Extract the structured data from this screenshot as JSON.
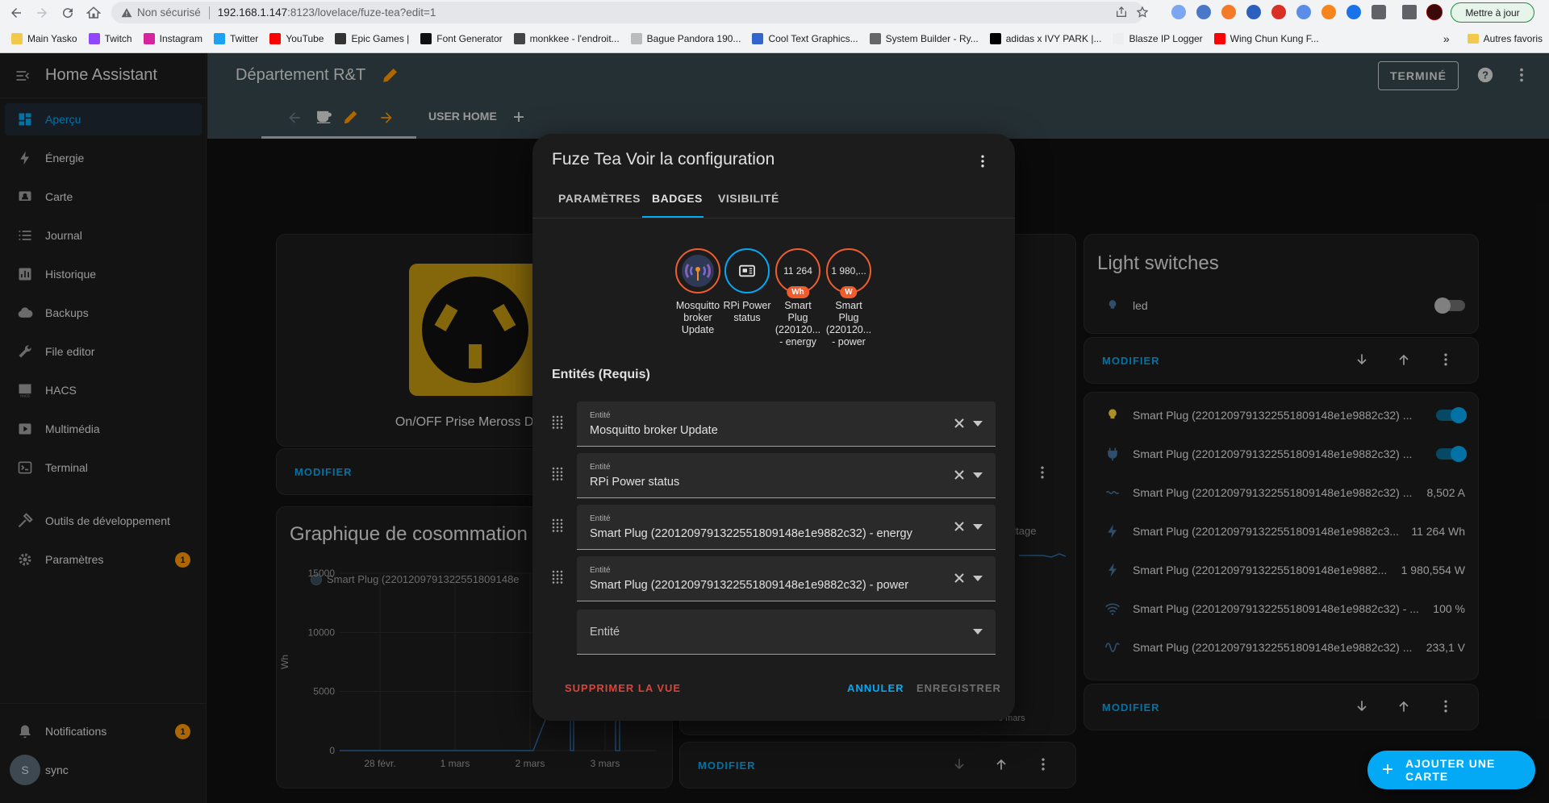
{
  "browser": {
    "security_label": "Non sécurisé",
    "url_host": "192.168.1.147",
    "url_rest": ":8123/lovelace/fuze-tea?edit=1",
    "update_button": "Mettre à jour",
    "bookmarks": [
      {
        "label": "Main Yasko",
        "color": "#f2c94c"
      },
      {
        "label": "Twitch",
        "color": "#9146ff"
      },
      {
        "label": "Instagram",
        "color": "#d6249f"
      },
      {
        "label": "Twitter",
        "color": "#1da1f2"
      },
      {
        "label": "YouTube",
        "color": "#ff0000"
      },
      {
        "label": "Epic Games |",
        "color": "#333333"
      },
      {
        "label": "Font Generator",
        "color": "#111111"
      },
      {
        "label": "monkkee - l'endroit...",
        "color": "#444444"
      },
      {
        "label": "Bague Pandora 190...",
        "color": "#bbbbbb"
      },
      {
        "label": "Cool Text Graphics...",
        "color": "#3366cc"
      },
      {
        "label": "System Builder - Ry...",
        "color": "#666666"
      },
      {
        "label": "adidas x IVY PARK |...",
        "color": "#000000"
      },
      {
        "label": "Blasze IP Logger",
        "color": "#eeeeee"
      },
      {
        "label": "Wing Chun Kung F...",
        "color": "#ff0000"
      }
    ],
    "bookmarks_overflow": "»",
    "other_bookmarks": "Autres favoris"
  },
  "sidebar": {
    "app_title": "Home Assistant",
    "items": [
      {
        "label": "Aperçu",
        "icon": "dashboard-icon",
        "active": true
      },
      {
        "label": "Énergie",
        "icon": "lightning-icon"
      },
      {
        "label": "Carte",
        "icon": "map-icon"
      },
      {
        "label": "Journal",
        "icon": "list-icon"
      },
      {
        "label": "Historique",
        "icon": "chart-icon"
      },
      {
        "label": "Backups",
        "icon": "cloud-icon"
      },
      {
        "label": "File editor",
        "icon": "wrench-icon"
      },
      {
        "label": "HACS",
        "icon": "hacs-icon"
      },
      {
        "label": "Multimédia",
        "icon": "play-icon"
      },
      {
        "label": "Terminal",
        "icon": "terminal-icon"
      }
    ],
    "dev_tools": "Outils de développement",
    "settings": "Paramètres",
    "settings_badge": "1",
    "notifications": "Notifications",
    "notifications_badge": "1",
    "user_initial": "S",
    "user_name": "sync"
  },
  "toolbar": {
    "dashboard_title": "Département R&T",
    "done_button": "TERMINÉ",
    "tab_user_home": "USER HOME"
  },
  "cards": {
    "prise_label": "On/OFF Prise Meross Depa",
    "modifier": "MODIFIER",
    "graph": {
      "title": "Graphique de cosommation",
      "legend": "Smart Plug (2201209791322551809148e",
      "y_unit": "Wh",
      "y_ticks": [
        "15000",
        "10000",
        "5000",
        "0"
      ],
      "x_ticks": [
        "28 févr.",
        "1 mars",
        "2 mars",
        "3 mars"
      ]
    },
    "middle_fragment": "oltage",
    "middle_xtick": "3 mars",
    "light_switches": {
      "title": "Light switches",
      "led_label": "led"
    },
    "entities_list": [
      {
        "name": "Smart Plug (2201209791322551809148e1e9882c32) ...",
        "value": "",
        "icon": "bulb-icon",
        "toggle": "on"
      },
      {
        "name": "Smart Plug (2201209791322551809148e1e9882c32) ...",
        "value": "",
        "icon": "plug-icon",
        "toggle": "on"
      },
      {
        "name": "Smart Plug (2201209791322551809148e1e9882c32) ...",
        "value": "8,502 A",
        "icon": "current-icon"
      },
      {
        "name": "Smart Plug (2201209791322551809148e1e9882c3...",
        "value": "11 264 Wh",
        "icon": "lightning-icon"
      },
      {
        "name": "Smart Plug (2201209791322551809148e1e9882...",
        "value": "1 980,554 W",
        "icon": "flash-icon"
      },
      {
        "name": "Smart Plug (2201209791322551809148e1e9882c32) - ...",
        "value": "100 %",
        "icon": "wifi-icon"
      },
      {
        "name": "Smart Plug (2201209791322551809148e1e9882c32) ...",
        "value": "233,1 V",
        "icon": "sine-wave-icon"
      }
    ],
    "add_card": "AJOUTER UNE CARTE"
  },
  "dialog": {
    "title": "Fuze Tea Voir la configuration",
    "tabs": [
      "PARAMÈTRES",
      "BADGES",
      "VISIBILITÉ"
    ],
    "active_tab": "BADGES",
    "badges": [
      {
        "value": "",
        "unit": "",
        "label": "Mosquitto broker Update",
        "icon": "mosquitto-icon"
      },
      {
        "value": "",
        "unit": "",
        "label": "RPi Power status",
        "icon": "raspberry-icon"
      },
      {
        "value": "11 264",
        "unit": "Wh",
        "label": "Smart Plug (220120... - energy"
      },
      {
        "value": "1 980,...",
        "unit": "W",
        "label": "Smart Plug (220120... - power"
      }
    ],
    "entities_title": "Entités (Requis)",
    "field_label": "Entité",
    "entities": [
      "Mosquitto broker Update",
      "RPi Power status",
      "Smart Plug (2201209791322551809148e1e9882c32) - energy",
      "Smart Plug (2201209791322551809148e1e9882c32) - power"
    ],
    "empty_placeholder": "Entité",
    "delete_button": "SUPPRIMER LA VUE",
    "cancel_button": "ANNULER",
    "save_button": "ENREGISTRER"
  }
}
